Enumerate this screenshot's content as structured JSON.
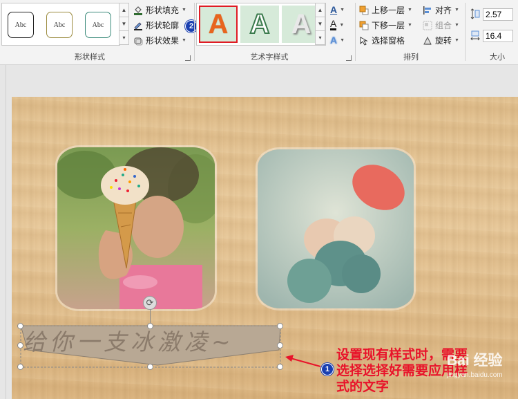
{
  "ribbon": {
    "shape_styles": {
      "group_label": "形状样式",
      "preset_label": "Abc",
      "preset_border_colors": [
        "#222222",
        "#9a8a3c",
        "#3a8a7a"
      ],
      "fill_label": "形状填充",
      "outline_label": "形状轮廓",
      "effects_label": "形状效果"
    },
    "wordart_styles": {
      "group_label": "艺术字样式",
      "glyph": "A",
      "items": [
        {
          "name": "orange-fill",
          "color": "#e8651e"
        },
        {
          "name": "white-outline",
          "color": "#ffffff"
        },
        {
          "name": "gray-shadow",
          "color": "#e8e8e8"
        }
      ]
    },
    "arrange": {
      "group_label": "排列",
      "bring_forward": "上移一层",
      "send_backward": "下移一层",
      "selection_pane": "选择窗格",
      "align": "对齐",
      "group": "组合",
      "rotate": "旋转"
    },
    "size": {
      "group_label": "大小",
      "height": "2.57",
      "width": "16.4"
    }
  },
  "slide": {
    "wordart_text": "给你一支冰激凌~",
    "annotation_text": "设置现有样式时，需要选择选择好需要应用样式的文字",
    "annotation_number": "1",
    "highlight_number": "2",
    "watermark_text": "Bai 经验",
    "watermark_url": "jingyan.baidu.com"
  },
  "colors": {
    "accent_red": "#e8132a",
    "badge_blue": "#1a3fb0"
  }
}
